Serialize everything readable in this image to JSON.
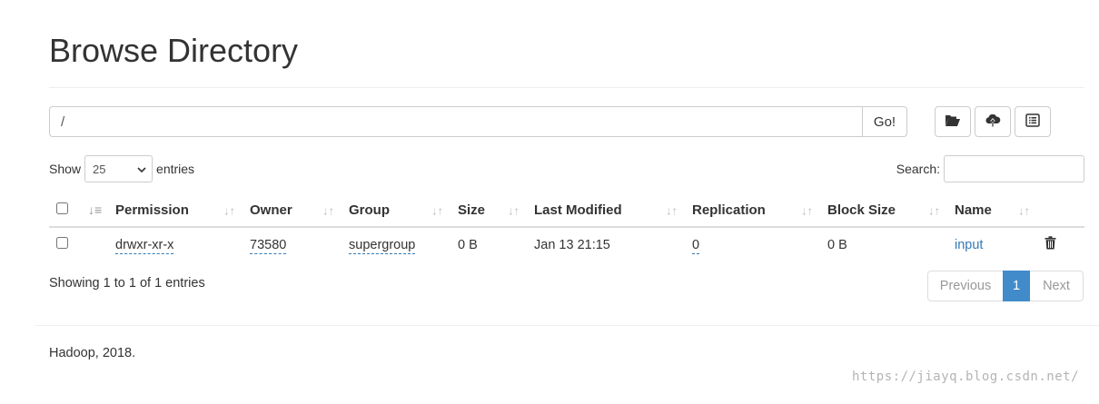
{
  "header": {
    "title": "Browse Directory"
  },
  "path_bar": {
    "value": "/",
    "go_label": "Go!"
  },
  "toolbar": {
    "icons": [
      "folder-open-icon",
      "cloud-upload-icon",
      "list-alt-icon"
    ]
  },
  "table_controls": {
    "show_label": "Show",
    "entries_label": "entries",
    "page_length": "25",
    "search_label": "Search:",
    "search_value": ""
  },
  "table": {
    "columns": [
      "Permission",
      "Owner",
      "Group",
      "Size",
      "Last Modified",
      "Replication",
      "Block Size",
      "Name"
    ],
    "rows": [
      {
        "permission": "drwxr-xr-x",
        "owner": "73580",
        "group": "supergroup",
        "size": "0 B",
        "last_modified": "Jan 13 21:15",
        "replication": "0",
        "block_size": "0 B",
        "name": "input"
      }
    ]
  },
  "footer_info": {
    "summary": "Showing 1 to 1 of 1 entries",
    "previous_label": "Previous",
    "current_page": "1",
    "next_label": "Next"
  },
  "footer": {
    "text": "Hadoop, 2018."
  },
  "watermark": "https://jiayq.blog.csdn.net/",
  "colors": {
    "link": "#337ab7",
    "active_page": "#428bca"
  }
}
